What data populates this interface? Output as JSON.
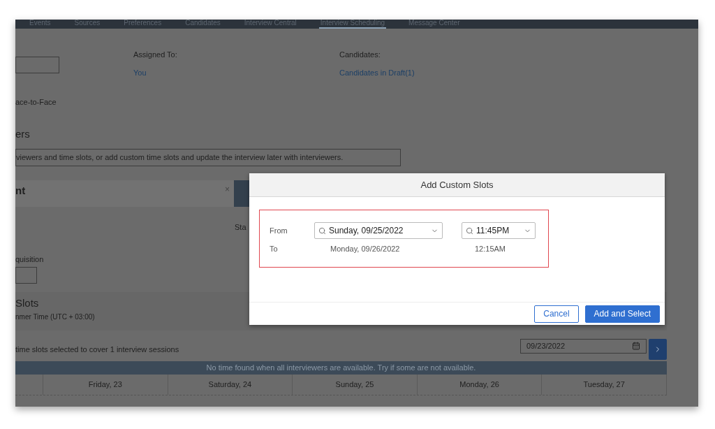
{
  "nav_tabs": [
    {
      "label": "Events",
      "selected": false
    },
    {
      "label": "Sources",
      "selected": false
    },
    {
      "label": "Preferences",
      "selected": false
    },
    {
      "label": "Candidates",
      "selected": false
    },
    {
      "label": "Interview Central",
      "selected": false
    },
    {
      "label": "Interview Scheduling",
      "selected": true
    },
    {
      "label": "Message Center",
      "selected": false
    }
  ],
  "assigned_to": {
    "label": "Assigned To:",
    "value": "You"
  },
  "candidates": {
    "label": "Candidates:",
    "value": "Candidates in Draft(1)"
  },
  "interview_type": "ace-to-Face",
  "section_title": "ers",
  "info_note": "viewers and time slots, or add custom time slots and update the interview later with interviewers.",
  "panel": {
    "title": "nt",
    "close": "×"
  },
  "start_label": "Sta",
  "requisition_label": "quisition",
  "slots": {
    "title": "Slots",
    "timezone": "nmer Time (UTC + 03:00)"
  },
  "summary": "time slots selected to cover 1 interview sessions",
  "date_field": {
    "value": "09/23/2022"
  },
  "banner": "No time found when all interviewers are available. Try if some are not available.",
  "day_columns": [
    "Friday, 23",
    "Saturday, 24",
    "Sunday, 25",
    "Monday, 26",
    "Tuesday, 27"
  ],
  "dialog": {
    "title": "Add Custom Slots",
    "from_label": "From",
    "from_date": "Sunday, 09/25/2022",
    "from_time": "11:45PM",
    "to_label": "To",
    "to_date": "Monday, 09/26/2022",
    "to_time": "12:15AM",
    "buttons": [
      {
        "label": "Cancel",
        "kind": "secondary"
      },
      {
        "label": "Add and Select",
        "kind": "primary"
      }
    ]
  }
}
